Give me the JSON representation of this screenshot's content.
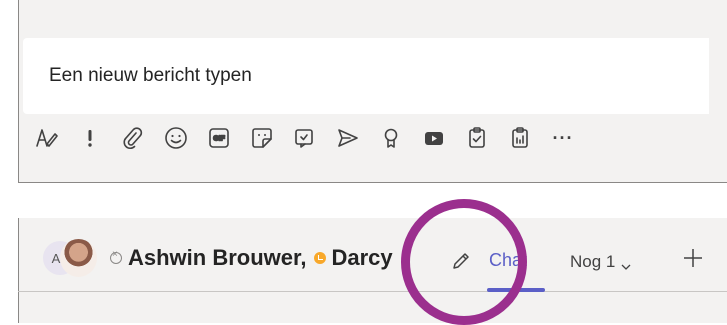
{
  "compose": {
    "placeholder": "Een nieuw bericht typen",
    "toolbar": [
      {
        "icon": "format-icon"
      },
      {
        "icon": "important-icon"
      },
      {
        "icon": "attach-icon"
      },
      {
        "icon": "emoji-icon"
      },
      {
        "icon": "gif-icon",
        "label": "GIF"
      },
      {
        "icon": "sticker-icon"
      },
      {
        "icon": "meet-now-icon"
      },
      {
        "icon": "send-icon"
      },
      {
        "icon": "praise-icon"
      },
      {
        "icon": "youtube-icon"
      },
      {
        "icon": "approvals-icon"
      },
      {
        "icon": "forms-icon"
      },
      {
        "icon": "more-options-icon",
        "label": "···"
      }
    ]
  },
  "chat_header": {
    "avatar_initial": "A",
    "title": "Ashwin Brouwer,",
    "second_name": "Darcy",
    "tabs": {
      "chat": "Chat",
      "more": "Nog 1"
    }
  },
  "colors": {
    "accent": "#5b5fc7",
    "annotation": "#9b2f8e",
    "away": "#f8a82a"
  }
}
